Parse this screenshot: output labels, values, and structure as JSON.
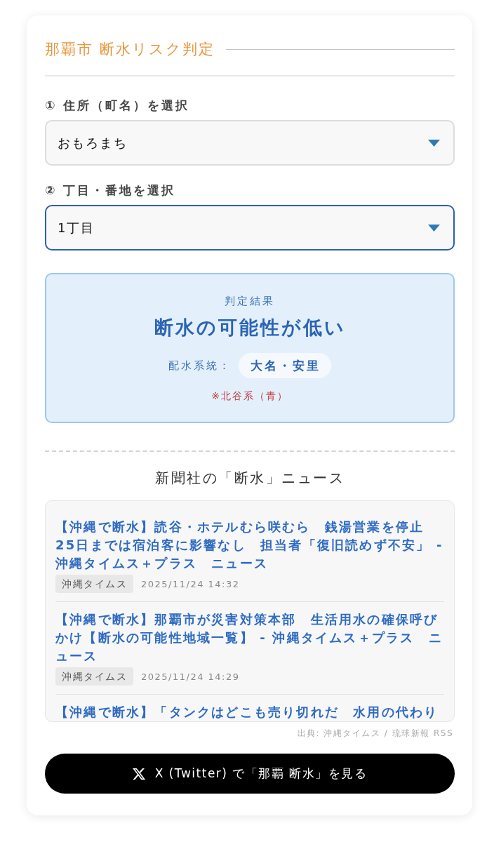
{
  "app": {
    "title": "那覇市 断水リスク判定"
  },
  "selects": [
    {
      "label": "① 住所（町名）を選択",
      "value": "おもろまち",
      "focused": false
    },
    {
      "label": "② 丁目・番地を選択",
      "value": "1丁目",
      "focused": true
    }
  ],
  "result": {
    "kind": "low",
    "label": "判定結果",
    "verdict": "断水の可能性が低い",
    "system_label": "配水系統：",
    "system": "大名・安里",
    "note": "※北谷系（青）"
  },
  "news": {
    "heading": "新聞社の「断水」ニュース",
    "items": [
      {
        "title": "【沖縄で断水】読谷・ホテルむら咲むら　銭湯営業を停止　25日までは宿泊客に影響なし　担当者「復旧読めず不安」 - 沖縄タイムス＋プラス　ニュース",
        "source": "沖縄タイムス",
        "date": "2025/11/24 14:32"
      },
      {
        "title": "【沖縄で断水】那覇市が災害対策本部　生活用水の確保呼びかけ【断水の可能性地域一覧】 - 沖縄タイムス＋プラス　ニュース",
        "source": "沖縄タイムス",
        "date": "2025/11/24 14:29"
      },
      {
        "title": "【沖縄で断水】「タンクはどこも売り切れだ　水用の代わり"
      }
    ],
    "credit": "出典: 沖縄タイムス / 琉球新報 RSS"
  },
  "x_button": {
    "label": "X (Twitter) で「那覇 断水」を見る"
  }
}
